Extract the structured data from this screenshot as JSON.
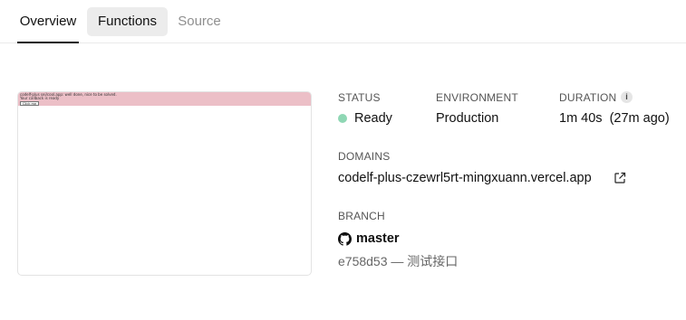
{
  "tabs": [
    {
      "label": "Overview",
      "active": true
    },
    {
      "label": "Functions",
      "active": false
    },
    {
      "label": "Source",
      "active": false
    }
  ],
  "preview": {
    "line1": "codelf-plus sei/cool.app: well done, nice to be solved.",
    "line2": "Your callback is ready",
    "button": "Click me",
    "bar_color": "#ecbfc7"
  },
  "status": {
    "label": "STATUS",
    "value": "Ready",
    "dot_color": "#8fd7b4"
  },
  "environment": {
    "label": "ENVIRONMENT",
    "value": "Production"
  },
  "duration": {
    "label": "DURATION",
    "value": "1m 40s",
    "ago": "(27m ago)",
    "info_icon": "i"
  },
  "domains": {
    "label": "DOMAINS",
    "value": "codelf-plus-czewrl5rt-mingxuann.vercel.app",
    "icon": "external-link-icon"
  },
  "branch": {
    "label": "BRANCH",
    "name": "master",
    "icon": "github-icon",
    "commit": "e758d53 — 测试接口"
  }
}
